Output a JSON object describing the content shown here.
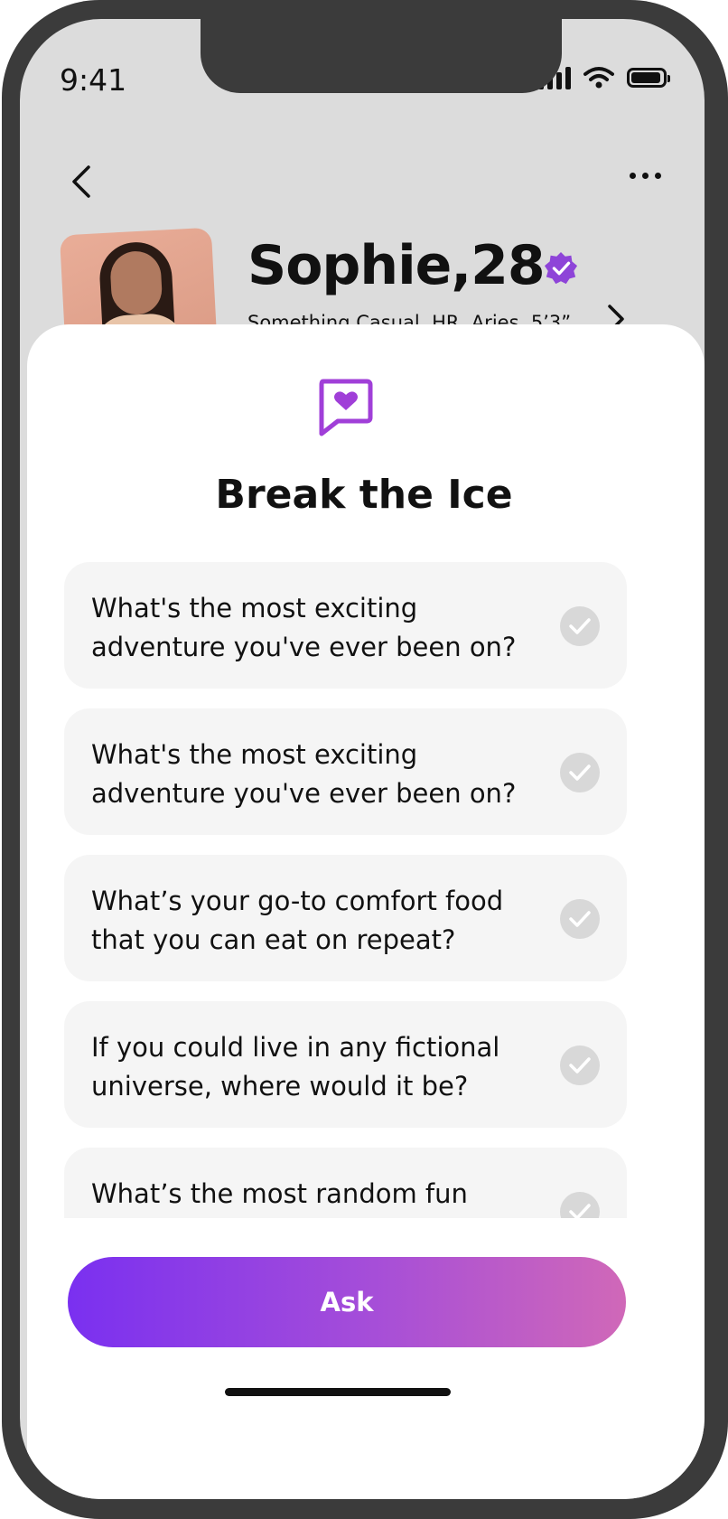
{
  "status_bar": {
    "time": "9:41"
  },
  "profile": {
    "name": "Sophie,28",
    "details": "Something Casual, HR, Aries, 5’3”,"
  },
  "sheet": {
    "title": "Break the Ice",
    "questions": [
      {
        "text": "What's the most exciting adventure you've ever been on?"
      },
      {
        "text": "What's the most exciting adventure you've ever been on?"
      },
      {
        "text": "What’s your go-to comfort food that you can eat on repeat?"
      },
      {
        "text": "If you could live in any fictional universe, where would it be?"
      },
      {
        "text": "What’s the most random fun fact"
      }
    ],
    "ask_label": "Ask"
  },
  "colors": {
    "accent_purple": "#8e44d8",
    "gradient_start": "#7a30f0",
    "gradient_end": "#d068b8",
    "card_bg": "#f5f5f5"
  }
}
